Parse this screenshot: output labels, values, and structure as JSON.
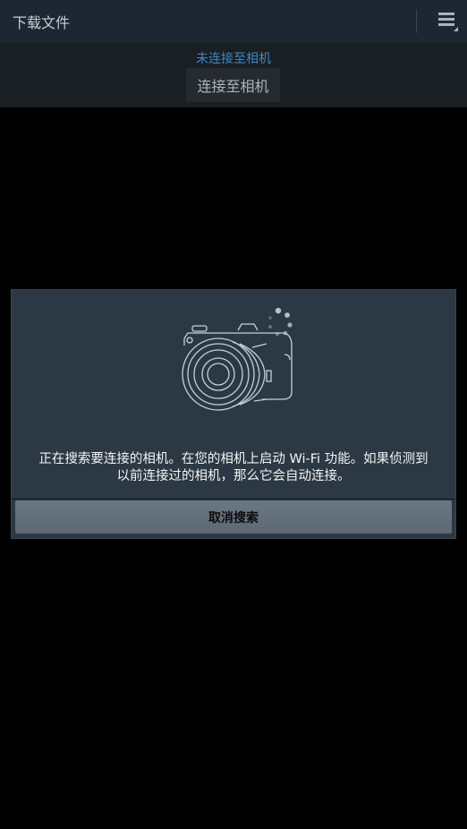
{
  "topbar": {
    "title": "下载文件",
    "menu_icon": "menu-icon"
  },
  "status": {
    "message": "未连接至相机",
    "connect_label": "连接至相机"
  },
  "dialog": {
    "illustration_icon": "camera-searching-icon",
    "message_line1": "正在搜索要连接的相机。在您的相机上启动 Wi-Fi 功能。如果侦测到",
    "message_line2": "以前连接过的相机，那么它会自动连接。",
    "cancel_label": "取消搜索"
  },
  "colors": {
    "topbar": "#1d2732",
    "accent": "#3d88c6",
    "dialog": "#2c3843",
    "button": "#5c6872"
  }
}
